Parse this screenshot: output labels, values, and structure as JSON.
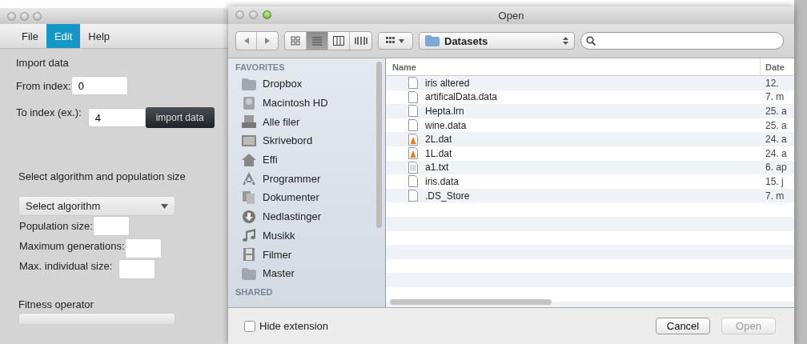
{
  "app_window": {
    "menu": [
      {
        "label": "File",
        "selected": false
      },
      {
        "label": "Edit",
        "selected": true
      },
      {
        "label": "Help",
        "selected": false
      }
    ],
    "import_section": {
      "title": "Import data",
      "from_label": "From index:",
      "from_value": "0",
      "to_label": "To index (ex.):",
      "to_value": "4",
      "button": "import data"
    },
    "algorithm_section": {
      "title": "Select algorithm and population size",
      "dropdown": "Select algorithm",
      "fields": [
        {
          "label": "Population size:"
        },
        {
          "label": "Maximum generations:"
        },
        {
          "label": "Max. individual size:"
        }
      ]
    },
    "fitness_section": {
      "title": "Fitness operator"
    }
  },
  "dialog": {
    "title": "Open",
    "view_modes": [
      {
        "kind": "icons",
        "selected": false
      },
      {
        "kind": "list",
        "selected": true
      },
      {
        "kind": "columns",
        "selected": false
      },
      {
        "kind": "coverflow",
        "selected": false
      }
    ],
    "location": "Datasets",
    "sidebar": {
      "favorites_heading": "FAVORITES",
      "items": [
        {
          "label": "Dropbox",
          "kind": "folder"
        },
        {
          "label": "Macintosh HD",
          "kind": "disk"
        },
        {
          "label": "Alle filer",
          "kind": "drawer"
        },
        {
          "label": "Skrivebord",
          "kind": "desktop"
        },
        {
          "label": "Effi",
          "kind": "home"
        },
        {
          "label": "Programmer",
          "kind": "apps"
        },
        {
          "label": "Dokumenter",
          "kind": "docs"
        },
        {
          "label": "Nedlastinger",
          "kind": "download"
        },
        {
          "label": "Musikk",
          "kind": "music"
        },
        {
          "label": "Filmer",
          "kind": "film"
        },
        {
          "label": "Master",
          "kind": "folder"
        }
      ],
      "shared_heading": "SHARED"
    },
    "table": {
      "columns": [
        "Name",
        "Date"
      ],
      "rows": [
        {
          "name": "iris altered",
          "date": "12.",
          "kind": "document"
        },
        {
          "name": "artificalData.data",
          "date": "7. m",
          "kind": "document"
        },
        {
          "name": "Hepta.lrn",
          "date": "25. a",
          "kind": "document"
        },
        {
          "name": "wine.data",
          "date": "25. a",
          "kind": "document"
        },
        {
          "name": "2L.dat",
          "date": "24. a",
          "kind": "cone"
        },
        {
          "name": "1L.dat",
          "date": "24. a",
          "kind": "cone"
        },
        {
          "name": "a1.txt",
          "date": "6. ap",
          "kind": "text"
        },
        {
          "name": "iris.data",
          "date": "15. j",
          "kind": "document"
        },
        {
          "name": ".DS_Store",
          "date": "7. m",
          "kind": "document"
        }
      ]
    },
    "hide_extension": {
      "label": "Hide extension",
      "checked": false
    },
    "buttons": [
      {
        "label": "Cancel",
        "disabled": false
      },
      {
        "label": "Open",
        "disabled": true
      }
    ]
  }
}
